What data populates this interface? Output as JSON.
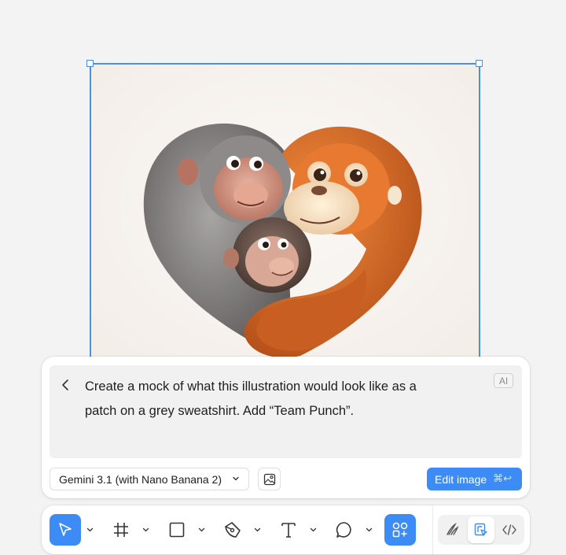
{
  "canvas": {
    "image_subject": "illustration of monkeys forming a heart shape"
  },
  "prompt_panel": {
    "back_icon": "chevron-left-icon",
    "prompt_line1": "Create a mock of what this illustration would look like as a",
    "prompt_line2": "patch on a grey sweatshirt. Add “Team Punch”.",
    "ai_badge": "AI",
    "model_label": "Gemini 3.1 (with Nano Banana 2)",
    "model_chevron_icon": "chevron-down-icon",
    "attach_icon": "image-attach-icon",
    "submit_label": "Edit image",
    "submit_shortcut": "⌘↩"
  },
  "toolbar": {
    "tools": [
      {
        "name": "move",
        "icon": "cursor-arrow-icon",
        "active": true
      },
      {
        "name": "frame",
        "icon": "hash-frame-icon",
        "active": false
      },
      {
        "name": "shape",
        "icon": "rectangle-icon",
        "active": false
      },
      {
        "name": "pen",
        "icon": "pen-tool-icon",
        "active": false
      },
      {
        "name": "text",
        "icon": "text-icon",
        "active": false
      },
      {
        "name": "comment",
        "icon": "comment-icon",
        "active": false
      },
      {
        "name": "actions",
        "icon": "actions-grid-icon",
        "active": true
      }
    ],
    "modes": [
      {
        "name": "draw",
        "icon": "draw-icon",
        "active": false
      },
      {
        "name": "design",
        "icon": "design-mode-icon",
        "active": true
      },
      {
        "name": "dev",
        "icon": "code-icon",
        "active": false
      }
    ]
  },
  "colors": {
    "accent": "#3d8cf5",
    "selection": "#4a90e2",
    "background": "#f3f3f3"
  }
}
